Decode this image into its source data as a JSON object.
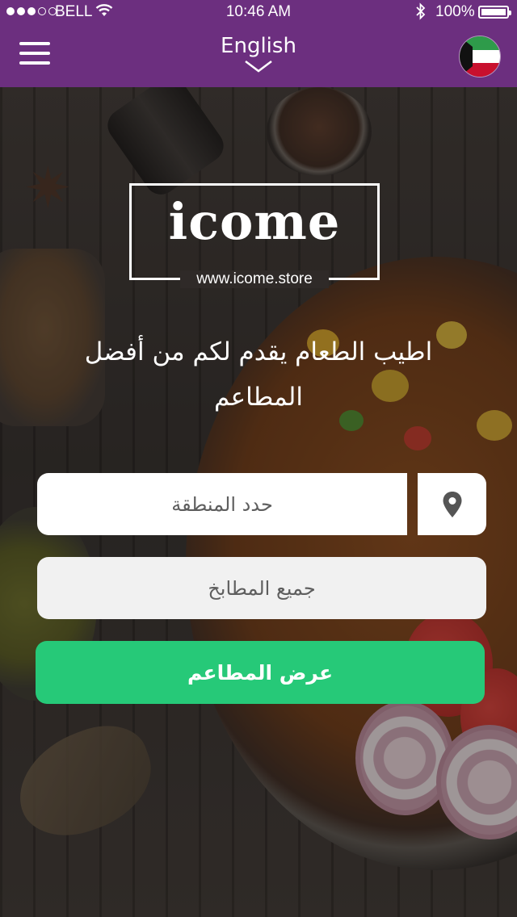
{
  "status_bar": {
    "carrier": "BELL",
    "time": "10:46 AM",
    "battery": "100%",
    "signal_bars_filled": 3,
    "signal_bars_total": 5
  },
  "header": {
    "language": "English",
    "menu_icon": "hamburger-menu-icon",
    "language_icon": "chevron-down-icon",
    "flag_icon": "kuwait-flag-icon"
  },
  "logo": {
    "name": "icome",
    "url": "www.icome.store"
  },
  "tagline": "اطيب الطعام يقدم لكم من أفضل المطاعم",
  "form": {
    "area_placeholder": "حدد المنطقة",
    "location_icon": "map-pin-icon",
    "cuisine_placeholder": "جميع المطابخ",
    "submit_label": "عرض المطاعم"
  },
  "colors": {
    "header": "#6c2f7f",
    "submit": "#26c978",
    "field_text": "#5e5e5e"
  }
}
